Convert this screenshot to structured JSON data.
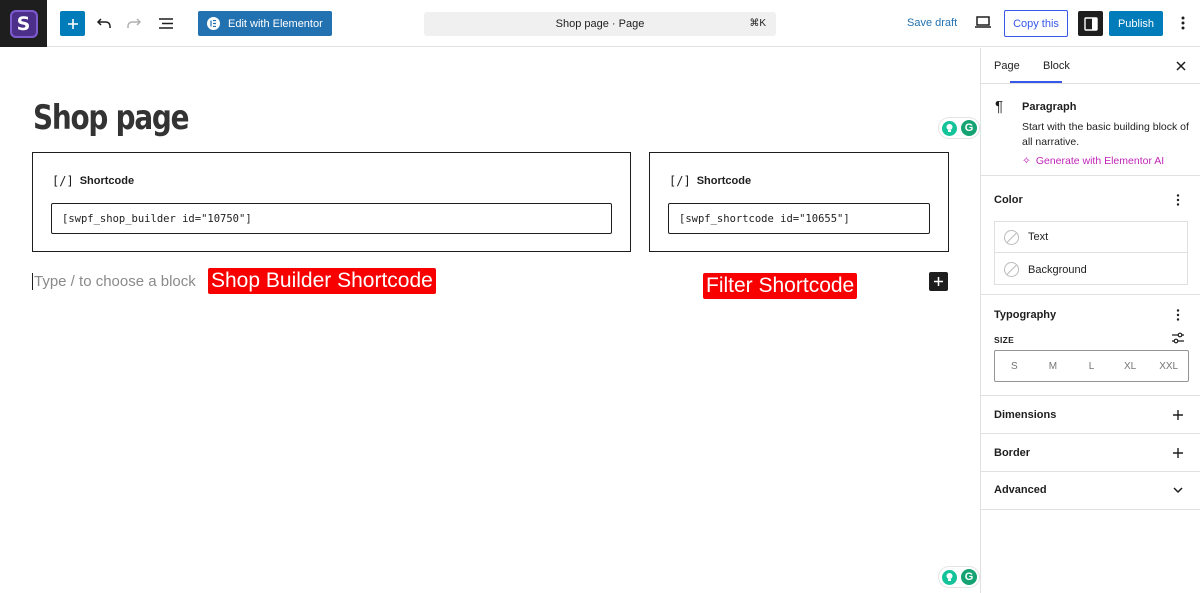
{
  "toolbar": {
    "site_logo_letter": "S",
    "edit_elementor_label": "Edit with Elementor",
    "command_title": "Shop page · Page",
    "command_shortcut": "⌘K",
    "save_draft_label": "Save draft",
    "copy_label": "Copy this",
    "publish_label": "Publish"
  },
  "canvas": {
    "page_title": "Shop page",
    "shortcodes": [
      {
        "label": "Shortcode",
        "glyph": "[/]",
        "value": "[swpf_shop_builder id=\"10750\"]"
      },
      {
        "label": "Shortcode",
        "glyph": "[/]",
        "value": "[swpf_shortcode id=\"10655\"]"
      }
    ],
    "placeholder": "Type / to choose a block",
    "annotations": {
      "shop_builder": "Shop Builder Shortcode",
      "filter": "Filter Shortcode"
    },
    "grammarly_letter": "G"
  },
  "sidebar": {
    "tabs": {
      "page": "Page",
      "block": "Block",
      "active": "Block"
    },
    "block": {
      "name": "Paragraph",
      "description": "Start with the basic building block of all narrative.",
      "ai_link": "Generate with Elementor AI"
    },
    "color": {
      "title": "Color",
      "items": [
        "Text",
        "Background"
      ]
    },
    "typography": {
      "title": "Typography",
      "size_label": "SIZE",
      "sizes": [
        "S",
        "M",
        "L",
        "XL",
        "XXL"
      ]
    },
    "dimensions": {
      "title": "Dimensions"
    },
    "border": {
      "title": "Border"
    },
    "advanced": {
      "title": "Advanced"
    }
  },
  "colors": {
    "wp_blue": "#007cba",
    "copy_outline": "#3858e9",
    "annotation_red": "#f80000",
    "ai_magenta": "#c026b8",
    "grammarly_green": "#15c39a"
  }
}
